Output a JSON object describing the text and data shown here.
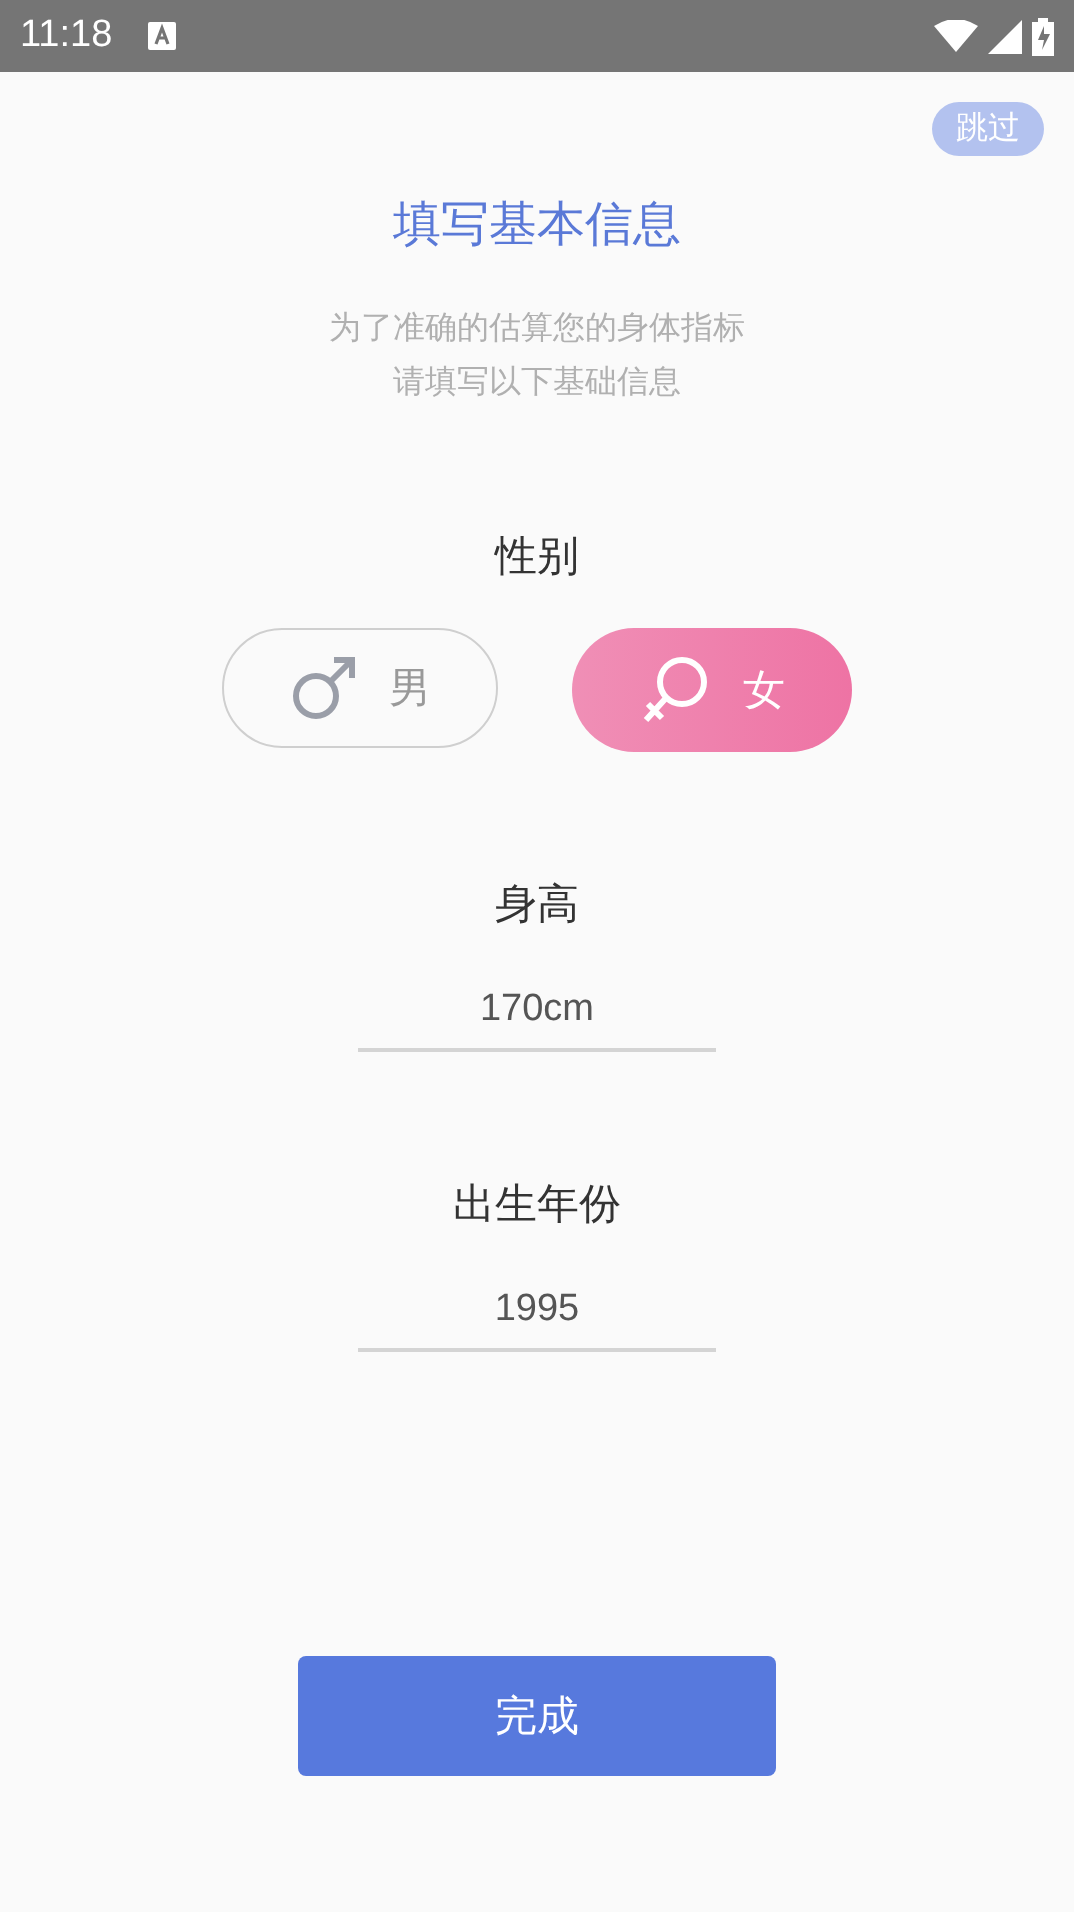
{
  "status_bar": {
    "time": "11:18"
  },
  "skip_button": "跳过",
  "title": "填写基本信息",
  "subtitle": [
    "为了准确的估算您的身体指标",
    "请填写以下基础信息"
  ],
  "gender": {
    "label": "性别",
    "options": [
      {
        "kind": "male",
        "label": "男",
        "selected": false
      },
      {
        "kind": "female",
        "label": "女",
        "selected": true
      }
    ]
  },
  "height": {
    "label": "身高",
    "value": "170cm"
  },
  "birth_year": {
    "label": "出生年份",
    "value": "1995"
  },
  "done_button": "完成"
}
